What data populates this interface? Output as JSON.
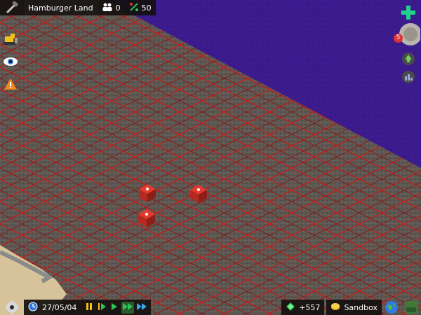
{
  "top_bar": {
    "city_name": "Hamburger Land",
    "population": "0",
    "money": "50",
    "tool_icon": "hammer-icon",
    "population_icon": "people-icon",
    "money_icon": "tax-icon"
  },
  "left_tools": [
    {
      "name": "bulldozer-tool-icon"
    },
    {
      "name": "view-eye-icon"
    },
    {
      "name": "warning-icon"
    }
  ],
  "right_panel": {
    "add_icon": "plus-icon",
    "notifications": "5",
    "upgrade_icon": "arrow-up-icon",
    "stats_icon": "stats-icon"
  },
  "bottom_bar": {
    "date": "27/05/04",
    "gems": "+557",
    "mode": "Sandbox",
    "speeds": [
      "pause",
      "play-slow",
      "play",
      "play-fast",
      "play-fastest"
    ],
    "selected_speed": "play-fast"
  },
  "colors": {
    "water": "#3a1a8a",
    "land": "#5f5751",
    "grid_lines": "#ff2a2a",
    "sand": "#d8c39a"
  }
}
